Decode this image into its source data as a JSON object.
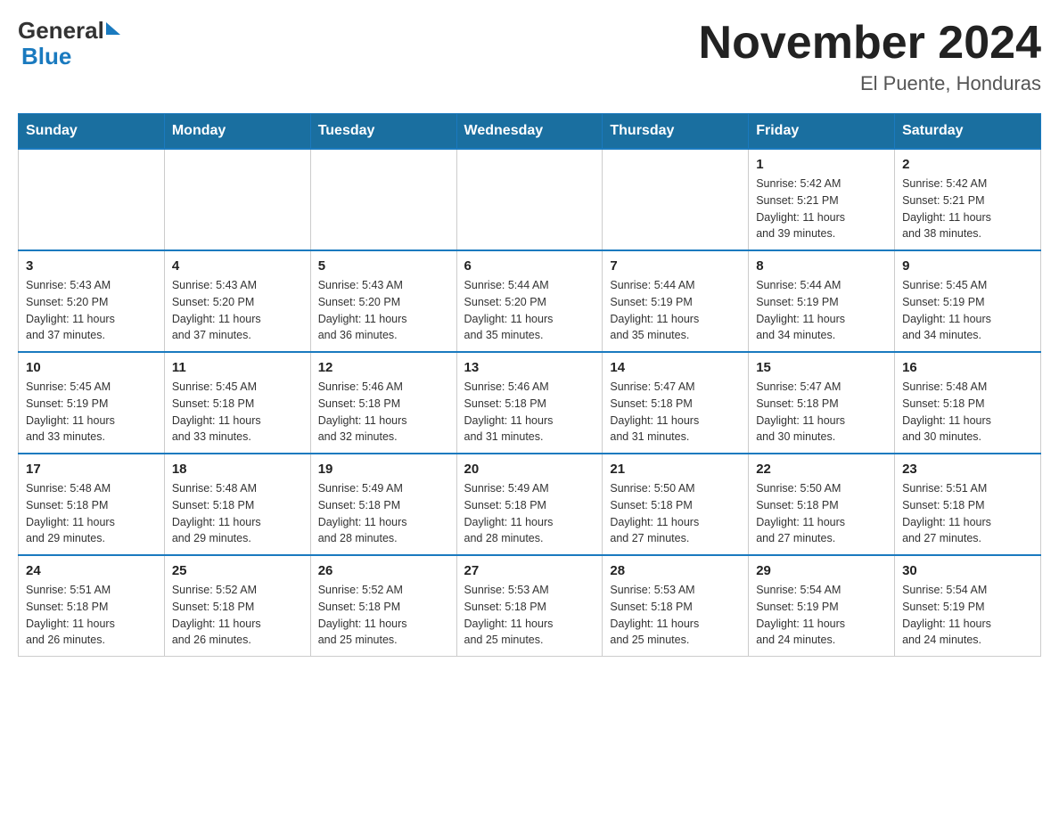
{
  "header": {
    "logo_general": "General",
    "logo_blue": "Blue",
    "title": "November 2024",
    "location": "El Puente, Honduras"
  },
  "calendar": {
    "days_of_week": [
      "Sunday",
      "Monday",
      "Tuesday",
      "Wednesday",
      "Thursday",
      "Friday",
      "Saturday"
    ],
    "weeks": [
      {
        "cells": [
          {
            "day": "",
            "info": ""
          },
          {
            "day": "",
            "info": ""
          },
          {
            "day": "",
            "info": ""
          },
          {
            "day": "",
            "info": ""
          },
          {
            "day": "",
            "info": ""
          },
          {
            "day": "1",
            "info": "Sunrise: 5:42 AM\nSunset: 5:21 PM\nDaylight: 11 hours\nand 39 minutes."
          },
          {
            "day": "2",
            "info": "Sunrise: 5:42 AM\nSunset: 5:21 PM\nDaylight: 11 hours\nand 38 minutes."
          }
        ]
      },
      {
        "cells": [
          {
            "day": "3",
            "info": "Sunrise: 5:43 AM\nSunset: 5:20 PM\nDaylight: 11 hours\nand 37 minutes."
          },
          {
            "day": "4",
            "info": "Sunrise: 5:43 AM\nSunset: 5:20 PM\nDaylight: 11 hours\nand 37 minutes."
          },
          {
            "day": "5",
            "info": "Sunrise: 5:43 AM\nSunset: 5:20 PM\nDaylight: 11 hours\nand 36 minutes."
          },
          {
            "day": "6",
            "info": "Sunrise: 5:44 AM\nSunset: 5:20 PM\nDaylight: 11 hours\nand 35 minutes."
          },
          {
            "day": "7",
            "info": "Sunrise: 5:44 AM\nSunset: 5:19 PM\nDaylight: 11 hours\nand 35 minutes."
          },
          {
            "day": "8",
            "info": "Sunrise: 5:44 AM\nSunset: 5:19 PM\nDaylight: 11 hours\nand 34 minutes."
          },
          {
            "day": "9",
            "info": "Sunrise: 5:45 AM\nSunset: 5:19 PM\nDaylight: 11 hours\nand 34 minutes."
          }
        ]
      },
      {
        "cells": [
          {
            "day": "10",
            "info": "Sunrise: 5:45 AM\nSunset: 5:19 PM\nDaylight: 11 hours\nand 33 minutes."
          },
          {
            "day": "11",
            "info": "Sunrise: 5:45 AM\nSunset: 5:18 PM\nDaylight: 11 hours\nand 33 minutes."
          },
          {
            "day": "12",
            "info": "Sunrise: 5:46 AM\nSunset: 5:18 PM\nDaylight: 11 hours\nand 32 minutes."
          },
          {
            "day": "13",
            "info": "Sunrise: 5:46 AM\nSunset: 5:18 PM\nDaylight: 11 hours\nand 31 minutes."
          },
          {
            "day": "14",
            "info": "Sunrise: 5:47 AM\nSunset: 5:18 PM\nDaylight: 11 hours\nand 31 minutes."
          },
          {
            "day": "15",
            "info": "Sunrise: 5:47 AM\nSunset: 5:18 PM\nDaylight: 11 hours\nand 30 minutes."
          },
          {
            "day": "16",
            "info": "Sunrise: 5:48 AM\nSunset: 5:18 PM\nDaylight: 11 hours\nand 30 minutes."
          }
        ]
      },
      {
        "cells": [
          {
            "day": "17",
            "info": "Sunrise: 5:48 AM\nSunset: 5:18 PM\nDaylight: 11 hours\nand 29 minutes."
          },
          {
            "day": "18",
            "info": "Sunrise: 5:48 AM\nSunset: 5:18 PM\nDaylight: 11 hours\nand 29 minutes."
          },
          {
            "day": "19",
            "info": "Sunrise: 5:49 AM\nSunset: 5:18 PM\nDaylight: 11 hours\nand 28 minutes."
          },
          {
            "day": "20",
            "info": "Sunrise: 5:49 AM\nSunset: 5:18 PM\nDaylight: 11 hours\nand 28 minutes."
          },
          {
            "day": "21",
            "info": "Sunrise: 5:50 AM\nSunset: 5:18 PM\nDaylight: 11 hours\nand 27 minutes."
          },
          {
            "day": "22",
            "info": "Sunrise: 5:50 AM\nSunset: 5:18 PM\nDaylight: 11 hours\nand 27 minutes."
          },
          {
            "day": "23",
            "info": "Sunrise: 5:51 AM\nSunset: 5:18 PM\nDaylight: 11 hours\nand 27 minutes."
          }
        ]
      },
      {
        "cells": [
          {
            "day": "24",
            "info": "Sunrise: 5:51 AM\nSunset: 5:18 PM\nDaylight: 11 hours\nand 26 minutes."
          },
          {
            "day": "25",
            "info": "Sunrise: 5:52 AM\nSunset: 5:18 PM\nDaylight: 11 hours\nand 26 minutes."
          },
          {
            "day": "26",
            "info": "Sunrise: 5:52 AM\nSunset: 5:18 PM\nDaylight: 11 hours\nand 25 minutes."
          },
          {
            "day": "27",
            "info": "Sunrise: 5:53 AM\nSunset: 5:18 PM\nDaylight: 11 hours\nand 25 minutes."
          },
          {
            "day": "28",
            "info": "Sunrise: 5:53 AM\nSunset: 5:18 PM\nDaylight: 11 hours\nand 25 minutes."
          },
          {
            "day": "29",
            "info": "Sunrise: 5:54 AM\nSunset: 5:19 PM\nDaylight: 11 hours\nand 24 minutes."
          },
          {
            "day": "30",
            "info": "Sunrise: 5:54 AM\nSunset: 5:19 PM\nDaylight: 11 hours\nand 24 minutes."
          }
        ]
      }
    ]
  }
}
